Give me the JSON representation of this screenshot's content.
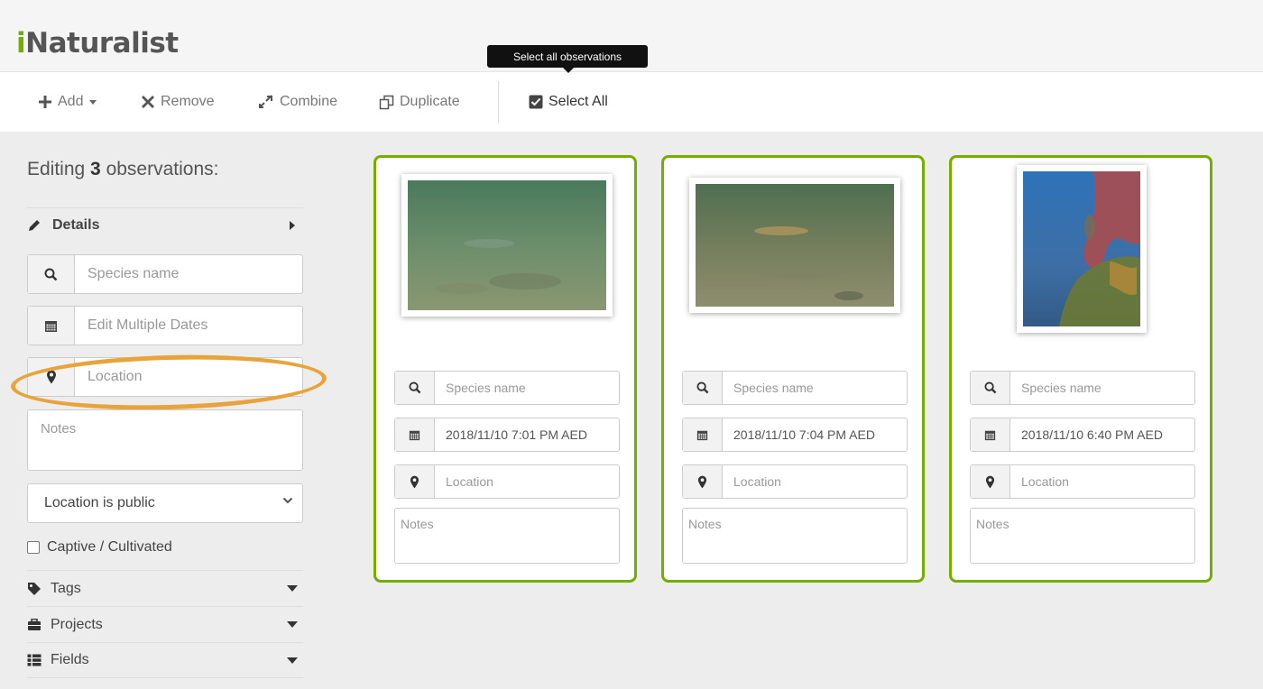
{
  "app": {
    "logo_i": "i",
    "logo_rest": "Naturalist",
    "accent": "#74ac00"
  },
  "toolbar": {
    "add_label": "Add",
    "remove_label": "Remove",
    "combine_label": "Combine",
    "duplicate_label": "Duplicate",
    "select_all_label": "Select All",
    "tooltip": "Select all observations"
  },
  "sidebar": {
    "editing_prefix": "Editing ",
    "editing_count": "3",
    "editing_suffix": " observations:",
    "details_label": "Details",
    "species_placeholder": "Species name",
    "dates_placeholder": "Edit Multiple Dates",
    "location_placeholder": "Location",
    "notes_placeholder": "Notes",
    "privacy_value": "Location is public",
    "captive_label": "Captive / Cultivated",
    "tags_label": "Tags",
    "projects_label": "Projects",
    "fields_label": "Fields",
    "highlight_color": "#e8a33b"
  },
  "cards": [
    {
      "species_placeholder": "Species name",
      "date": "2018/11/10 7:01 PM AED",
      "location_placeholder": "Location",
      "notes_placeholder": "Notes"
    },
    {
      "species_placeholder": "Species name",
      "date": "2018/11/10 7:04 PM AED",
      "location_placeholder": "Location",
      "notes_placeholder": "Notes"
    },
    {
      "species_placeholder": "Species name",
      "date": "2018/11/10 6:40 PM AED",
      "location_placeholder": "Location",
      "notes_placeholder": "Notes"
    }
  ]
}
